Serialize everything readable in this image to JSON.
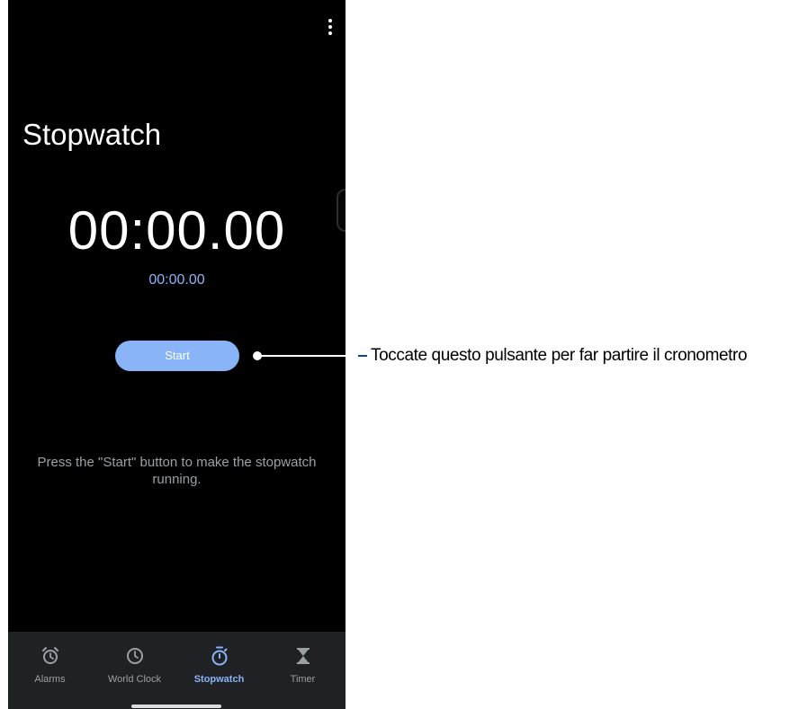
{
  "header": {
    "menu_icon": "more-vert-icon"
  },
  "page": {
    "title": "Stopwatch"
  },
  "stopwatch": {
    "main_time": "00:00.00",
    "lap_time": "00:00.00",
    "start_label": "Start",
    "hint": "Press the \"Start\" button to make the stopwatch running."
  },
  "nav": {
    "items": [
      {
        "label": "Alarms",
        "icon": "alarm-icon",
        "active": false
      },
      {
        "label": "World Clock",
        "icon": "clock-icon",
        "active": false
      },
      {
        "label": "Stopwatch",
        "icon": "stopwatch-icon",
        "active": true
      },
      {
        "label": "Timer",
        "icon": "hourglass-icon",
        "active": false
      }
    ]
  },
  "annotation": {
    "text": "Toccate questo pulsante per far partire il cronometro"
  },
  "colors": {
    "background": "#000000",
    "accent": "#8ab4f8",
    "nav_background": "#202124",
    "inactive_text": "#9aa0a6",
    "callout_line": "#0a4a8a"
  }
}
